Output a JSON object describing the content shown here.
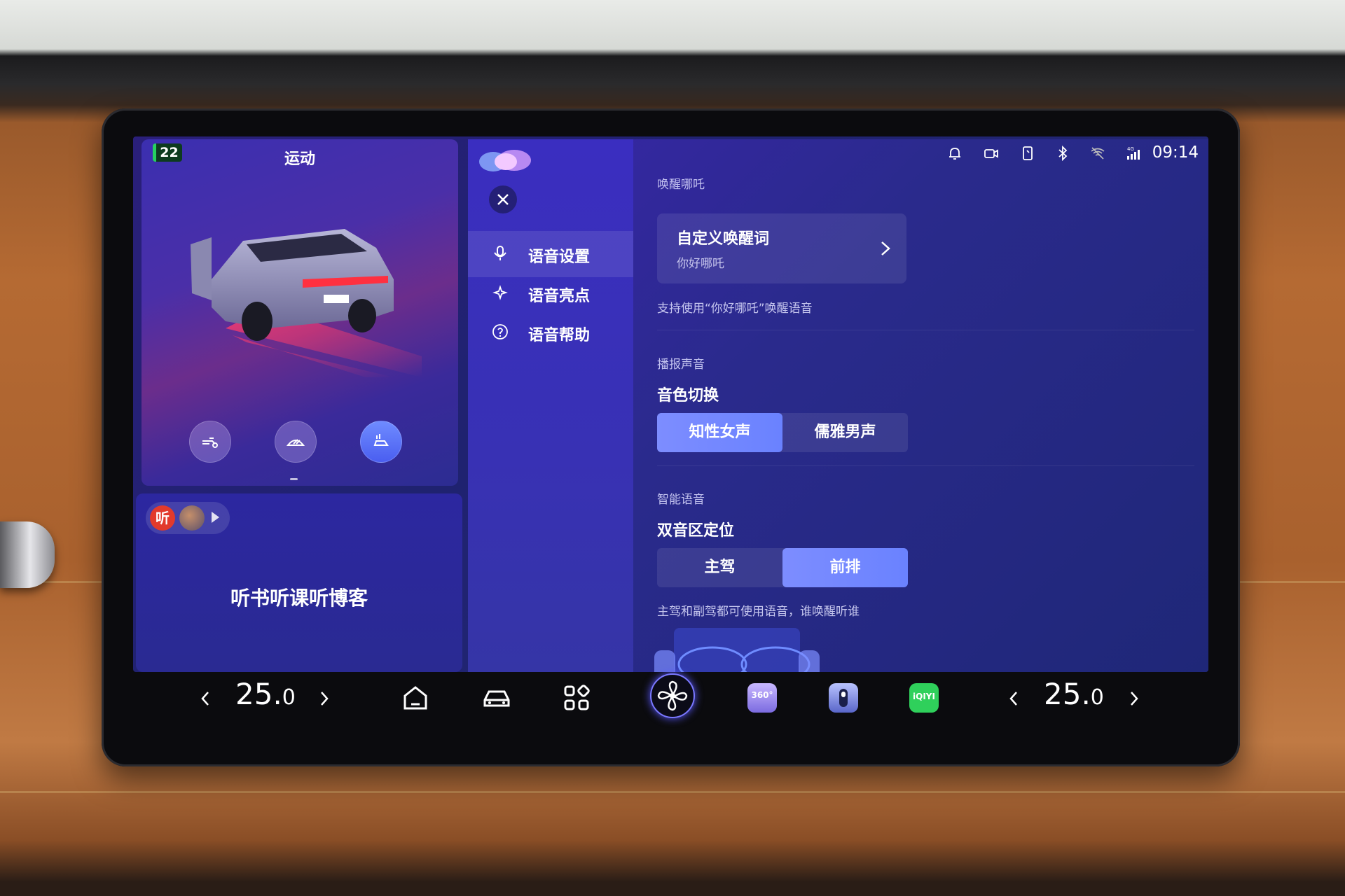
{
  "status_bar": {
    "time": "09:14",
    "icons": [
      "bell-icon",
      "camera-icon",
      "phone-icon",
      "bluetooth-icon",
      "wifi-off-icon",
      "signal-4g-icon"
    ],
    "signal_label": "4G"
  },
  "vehicle_card": {
    "badge": "22",
    "mode": "运动",
    "buttons": [
      "charge-port-icon",
      "wiper-icon",
      "car-sound-icon"
    ],
    "colors": {
      "badge_bg": "#0d3b1f",
      "badge_accent": "#25d15f"
    }
  },
  "media_card": {
    "app_logo_text": "听",
    "title": "听书听课听博客"
  },
  "voice_nav": {
    "items": [
      {
        "label": "语音设置",
        "icon": "microphone-icon",
        "active": true
      },
      {
        "label": "语音亮点",
        "icon": "sparkle-icon",
        "active": false
      },
      {
        "label": "语音帮助",
        "icon": "help-circle-icon",
        "active": false
      }
    ]
  },
  "wake": {
    "section": "唤醒哪吒",
    "card_title": "自定义唤醒词",
    "card_sub": "你好哪吒",
    "hint": "支持使用“你好哪吒”唤醒语音"
  },
  "broadcast": {
    "section": "播报声音",
    "title": "音色切换",
    "options": [
      "知性女声",
      "儒雅男声"
    ],
    "selected": 0
  },
  "smart": {
    "section": "智能语音",
    "title": "双音区定位",
    "options": [
      "主驾",
      "前排"
    ],
    "selected": 1,
    "hint": "主驾和副驾都可使用语音，谁唤醒听谁"
  },
  "dock": {
    "left_temp": "25.",
    "left_temp_decimal": "0",
    "right_temp": "25.",
    "right_temp_decimal": "0",
    "icons": [
      "home-icon",
      "car-icon",
      "apps-grid-icon",
      "fan-icon",
      "camera-360-icon",
      "phone-key-icon",
      "iqiyi-icon"
    ],
    "tile_360_text": "360°",
    "tile_iqiyi_text": "iQIYI"
  },
  "colors": {
    "accent": "#6a82ff",
    "panel": "#2a2a8c",
    "nav": "#3a2ec0"
  }
}
